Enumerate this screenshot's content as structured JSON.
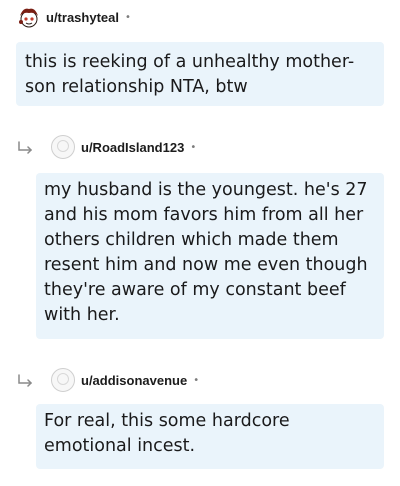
{
  "comments": [
    {
      "username": "u/trashyteal",
      "separator": "•",
      "avatar_icon": "snoo-avatar-icon",
      "text": "this is reeking of a unhealthy mother-son relationship NTA, btw"
    },
    {
      "username": "u/RoadIsland123",
      "separator": "•",
      "avatar_icon": "default-avatar-icon",
      "reply_icon": "reply-arrow-icon",
      "text": "my husband is the youngest. he's 27 and his mom favors him from all her others children which made them resent him and now me even though they're aware of my constant beef with her."
    },
    {
      "username": "u/addisonavenue",
      "separator": "•",
      "avatar_icon": "default-avatar-icon",
      "reply_icon": "reply-arrow-icon",
      "text": "For real, this some hardcore emotional incest."
    }
  ],
  "colors": {
    "bubble_bg": "#eaf4fb",
    "text": "#1a1a1b",
    "meta": "#7c7c7c"
  }
}
